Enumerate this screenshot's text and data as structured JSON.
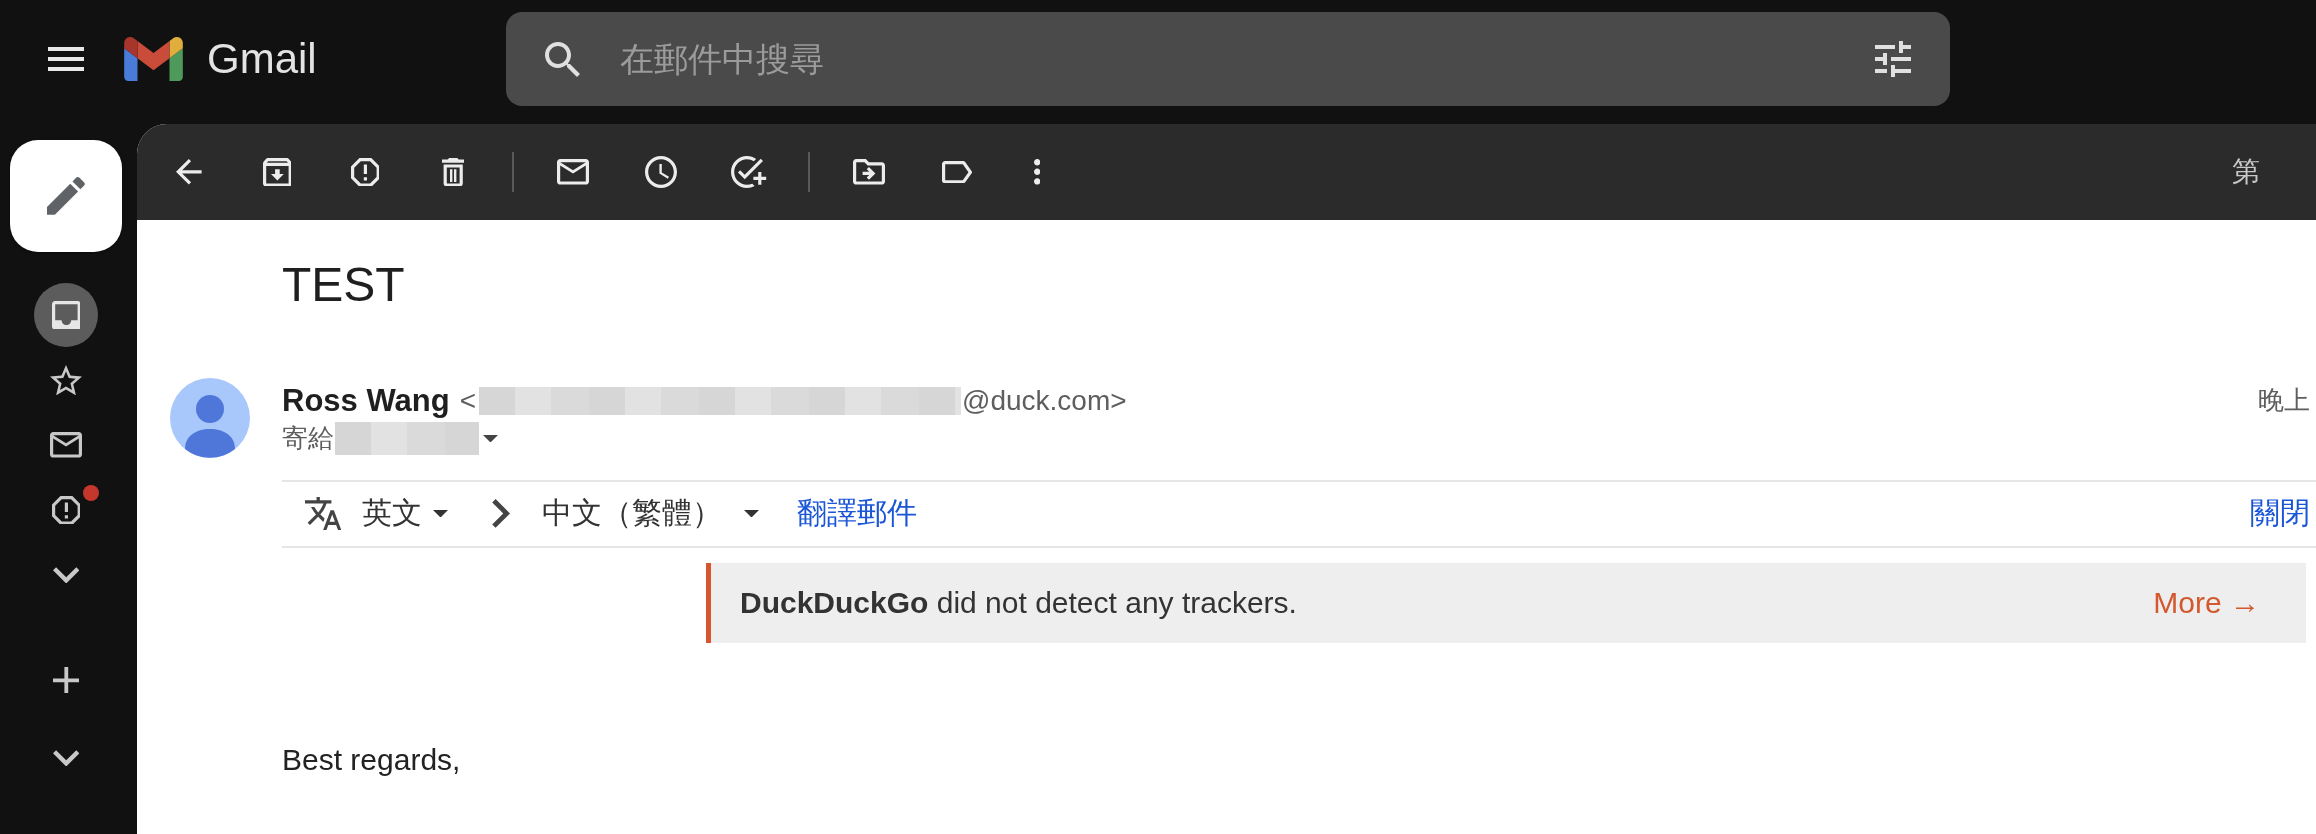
{
  "top_bar": {
    "app_name": "Gmail",
    "search": {
      "placeholder": "在郵件中搜尋"
    }
  },
  "nav_rail": {
    "items": [
      {
        "kind": "inbox",
        "selected": true,
        "dot": false
      },
      {
        "kind": "starred",
        "selected": false,
        "dot": false
      },
      {
        "kind": "mail",
        "selected": false,
        "dot": false
      },
      {
        "kind": "spam",
        "selected": false,
        "dot": true
      },
      {
        "kind": "more",
        "selected": false,
        "dot": false
      }
    ],
    "label_items": [
      {
        "kind": "add"
      },
      {
        "kind": "more"
      }
    ]
  },
  "toolbar": {
    "actions": [
      {
        "kind": "back"
      },
      {
        "kind": "archive"
      },
      {
        "kind": "spam"
      },
      {
        "kind": "delete"
      },
      {
        "kind": "divider"
      },
      {
        "kind": "unread"
      },
      {
        "kind": "snooze"
      },
      {
        "kind": "task"
      },
      {
        "kind": "divider"
      },
      {
        "kind": "move"
      },
      {
        "kind": "label"
      },
      {
        "kind": "more"
      }
    ],
    "page_info": "第"
  },
  "message": {
    "subject": "TEST",
    "sender": {
      "name": "Ross Wang",
      "email_start": "<",
      "email_redacted": true,
      "email_end": "@duck.com>"
    },
    "time": "晚上",
    "recipients": {
      "label": "寄給",
      "redacted": true
    }
  },
  "translation_bar": {
    "source_language": "英文",
    "target_language": "中文（繁體）",
    "translate_link": "翻譯郵件",
    "close_link": "關閉"
  },
  "tracker_banner": {
    "text": "**DuckDuckGo** did not detect any trackers.",
    "more_link": "More →"
  },
  "body": {
    "paragraphs": [
      "Best regards,"
    ]
  }
}
